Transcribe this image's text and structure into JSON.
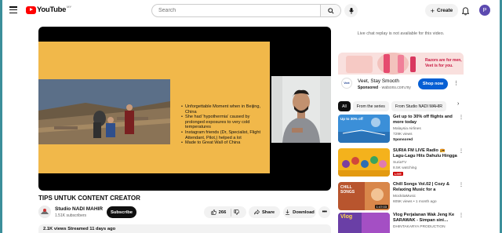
{
  "header": {
    "logo_text": "YouTube",
    "logo_region": "MY",
    "search_placeholder": "Search",
    "create_label": "Create",
    "avatar_letter": "P"
  },
  "player": {
    "slide_bullets": [
      "Unforgettable Moment when in Beijing, China",
      "She had 'hypothermia' caused by prolonged exposures to very cold temperatures",
      "Instagram friends (Dr, Specialist, Flight Attendant, Pilot,) helped a lot",
      "Made to Great Wall of China"
    ]
  },
  "video": {
    "title": "TIPS UNTUK CONTENT CREATOR",
    "channel_name": "Studio NADI MAHIR",
    "subscribers": "1.51K subscribers",
    "subscribe_label": "Subscribe",
    "likes": "266",
    "share_label": "Share",
    "download_label": "Download",
    "description_meta": "2.1K views  Streamed 11 days ago"
  },
  "sidebar": {
    "replay_note": "Live chat replay is not available for this video.",
    "ad": {
      "title": "Veet, Stay Smooth",
      "sponsored": "Sponsored",
      "domain": "watsons.com.my",
      "cta": "Shop now",
      "banner_text": "Razors are for men, Veet is for you.",
      "logo_text": "Veet"
    },
    "chips": [
      "All",
      "From the series",
      "From Studio NADI MAHIR"
    ],
    "recommendations": [
      {
        "title": "Get up to 30% off flights and more today",
        "channel": "Malaysia Airlines",
        "views": "729K views",
        "tag": "Sponsored",
        "thumb_label": "Up to 30% off",
        "duration": ""
      },
      {
        "title": "SURIA FM LIVE Radio 📻 Lagu-Lagu Hits Dahulu Hingga Yang…",
        "channel": "SuriaTV",
        "views": "8.5K watching",
        "tag": "LIVE",
        "thumb_label": "",
        "duration": ""
      },
      {
        "title": "Chill Songs Vol.02 | Cozy & Relaxing Music for a Peaceful…",
        "channel": "MockitaMusic",
        "views": "605K views • 1 month ago",
        "tag": "",
        "thumb_label": "CHILL SONGS",
        "duration": "1:47:03"
      },
      {
        "title": "Vlog Perjalanan Wak Jeng Ke SARAWAK - Simpan sini…",
        "channel": "DHINTAKARYA PRODUCTION",
        "views": "",
        "tag": "",
        "thumb_label": "Vlog",
        "duration": ""
      }
    ]
  }
}
